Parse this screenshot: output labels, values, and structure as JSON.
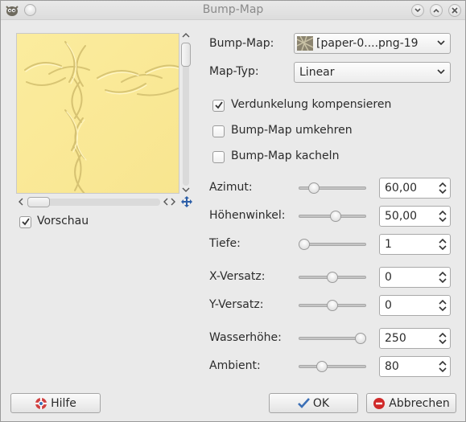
{
  "window": {
    "title": "Bump-Map"
  },
  "preview": {
    "checkbox_label": "Vorschau",
    "checked": true
  },
  "fields": {
    "bump_map_label": "Bump-Map:",
    "bump_map_value": "[paper-0....png-19",
    "map_typ_label": "Map-Typ:",
    "map_typ_value": "Linear"
  },
  "options": [
    {
      "label": "Verdunkelung kompensieren",
      "checked": true
    },
    {
      "label": "Bump-Map umkehren",
      "checked": false
    },
    {
      "label": "Bump-Map kacheln",
      "checked": false
    }
  ],
  "sliders": [
    {
      "label": "Azimut:",
      "value": "60,00",
      "fraction": 0.17
    },
    {
      "label": "Höhenwinkel:",
      "value": "50,00",
      "fraction": 0.55
    },
    {
      "label": "Tiefe:",
      "value": "1",
      "fraction": 0.0
    },
    {
      "label": "X-Versatz:",
      "value": "0",
      "fraction": 0.5
    },
    {
      "label": "Y-Versatz:",
      "value": "0",
      "fraction": 0.5
    },
    {
      "label": "Wasserhöhe:",
      "value": "250",
      "fraction": 1.0
    },
    {
      "label": "Ambient:",
      "value": "80",
      "fraction": 0.31
    }
  ],
  "buttons": {
    "help": "Hilfe",
    "ok": "OK",
    "cancel": "Abbrechen"
  },
  "colors": {
    "window_bg": "#eaeaea",
    "preview_paper": "#fbe99a",
    "ok_check": "#3b6fb6",
    "cancel_red": "#d02a2a"
  }
}
